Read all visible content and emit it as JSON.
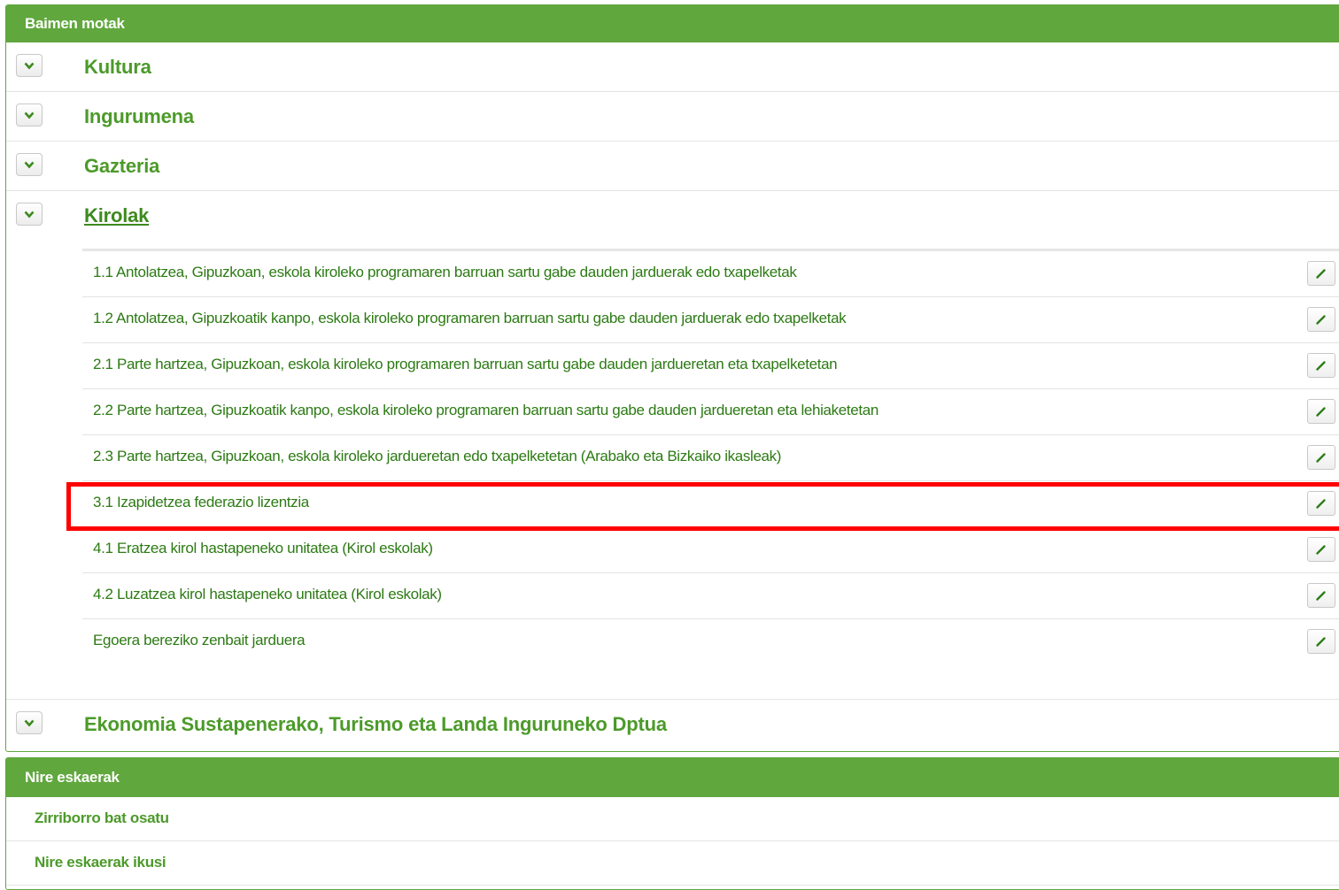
{
  "permit_types": {
    "header": "Baimen motak",
    "categories": [
      {
        "label": "Kultura"
      },
      {
        "label": "Ingurumena"
      },
      {
        "label": "Gazteria"
      },
      {
        "label": "Kirolak"
      },
      {
        "label": "Ekonomia Sustapenerako, Turismo eta Landa Inguruneko Dptua"
      }
    ],
    "kirolak_items": [
      {
        "label": "1.1 Antolatzea, Gipuzkoan, eskola kiroleko programaren barruan sartu gabe dauden jarduerak edo txapelketak"
      },
      {
        "label": "1.2 Antolatzea, Gipuzkoatik kanpo, eskola kiroleko programaren barruan sartu gabe dauden jarduerak edo txapelketak"
      },
      {
        "label": "2.1 Parte hartzea, Gipuzkoan, eskola kiroleko programaren barruan sartu gabe dauden jardueretan eta txapelketetan"
      },
      {
        "label": "2.2 Parte hartzea, Gipuzkoatik kanpo, eskola kiroleko programaren barruan sartu gabe dauden jardueretan eta lehiaketetan"
      },
      {
        "label": "2.3 Parte hartzea, Gipuzkoan, eskola kiroleko jardueretan edo txapelketetan (Arabako eta Bizkaiko ikasleak)"
      },
      {
        "label": "3.1 Izapidetzea federazio lizentzia"
      },
      {
        "label": "4.1 Eratzea kirol hastapeneko unitatea (Kirol eskolak)"
      },
      {
        "label": "4.2 Luzatzea kirol hastapeneko unitatea (Kirol eskolak)"
      },
      {
        "label": "Egoera bereziko zenbait jarduera"
      }
    ]
  },
  "my_requests": {
    "header": "Nire eskaerak",
    "links": [
      {
        "label": "Zirriborro bat osatu"
      },
      {
        "label": "Nire eskaerak ikusi"
      }
    ]
  },
  "colors": {
    "brand_green": "#60a73d",
    "link_green": "#4c9a2a",
    "highlight": "#ff0000"
  },
  "icons": {
    "toggle": "chevron-down-icon",
    "edit": "pencil-icon"
  }
}
